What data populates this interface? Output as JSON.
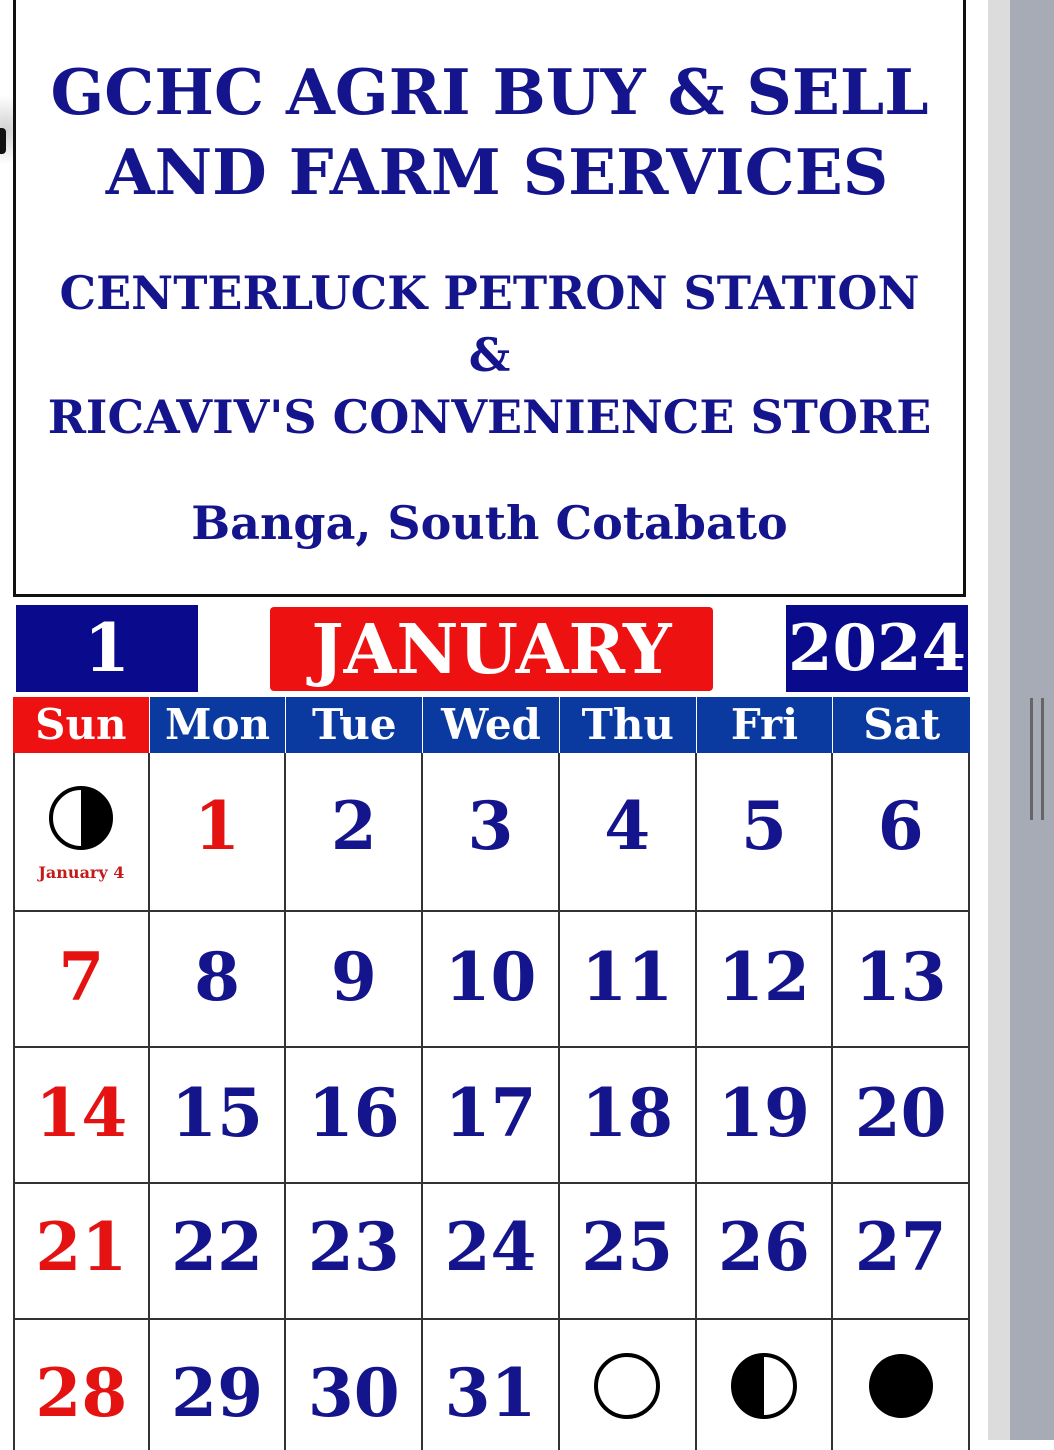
{
  "header": {
    "title_line1": "GCHC AGRI BUY & SELL",
    "title_line2": "AND FARM SERVICES",
    "sub_line1": "CENTERLUCK PETRON STATION",
    "sub_line2": "&",
    "sub_line3": "RICAVIV'S CONVENIENCE STORE",
    "location": "Banga, South Cotabato"
  },
  "month_bar": {
    "month_number": "1",
    "month_name": "JANUARY",
    "year": "2024"
  },
  "days_of_week": [
    "Sun",
    "Mon",
    "Tue",
    "Wed",
    "Thu",
    "Fri",
    "Sat"
  ],
  "weeks": [
    [
      "",
      "1",
      "2",
      "3",
      "4",
      "5",
      "6"
    ],
    [
      "7",
      "8",
      "9",
      "10",
      "11",
      "12",
      "13"
    ],
    [
      "14",
      "15",
      "16",
      "17",
      "18",
      "19",
      "20"
    ],
    [
      "21",
      "22",
      "23",
      "24",
      "25",
      "26",
      "27"
    ],
    [
      "28",
      "29",
      "30",
      "31",
      "",
      "",
      ""
    ]
  ],
  "moon_phases": {
    "last_quarter_caption": "January 4",
    "icons": [
      "last-quarter-moon-icon",
      "full-moon-icon",
      "first-quarter-moon-icon",
      "new-moon-icon"
    ]
  },
  "colors": {
    "title_blue": "#14148c",
    "bar_blue": "#0a0a8c",
    "header_row_blue": "#0a3aa0",
    "accent_red": "#ee1111"
  }
}
